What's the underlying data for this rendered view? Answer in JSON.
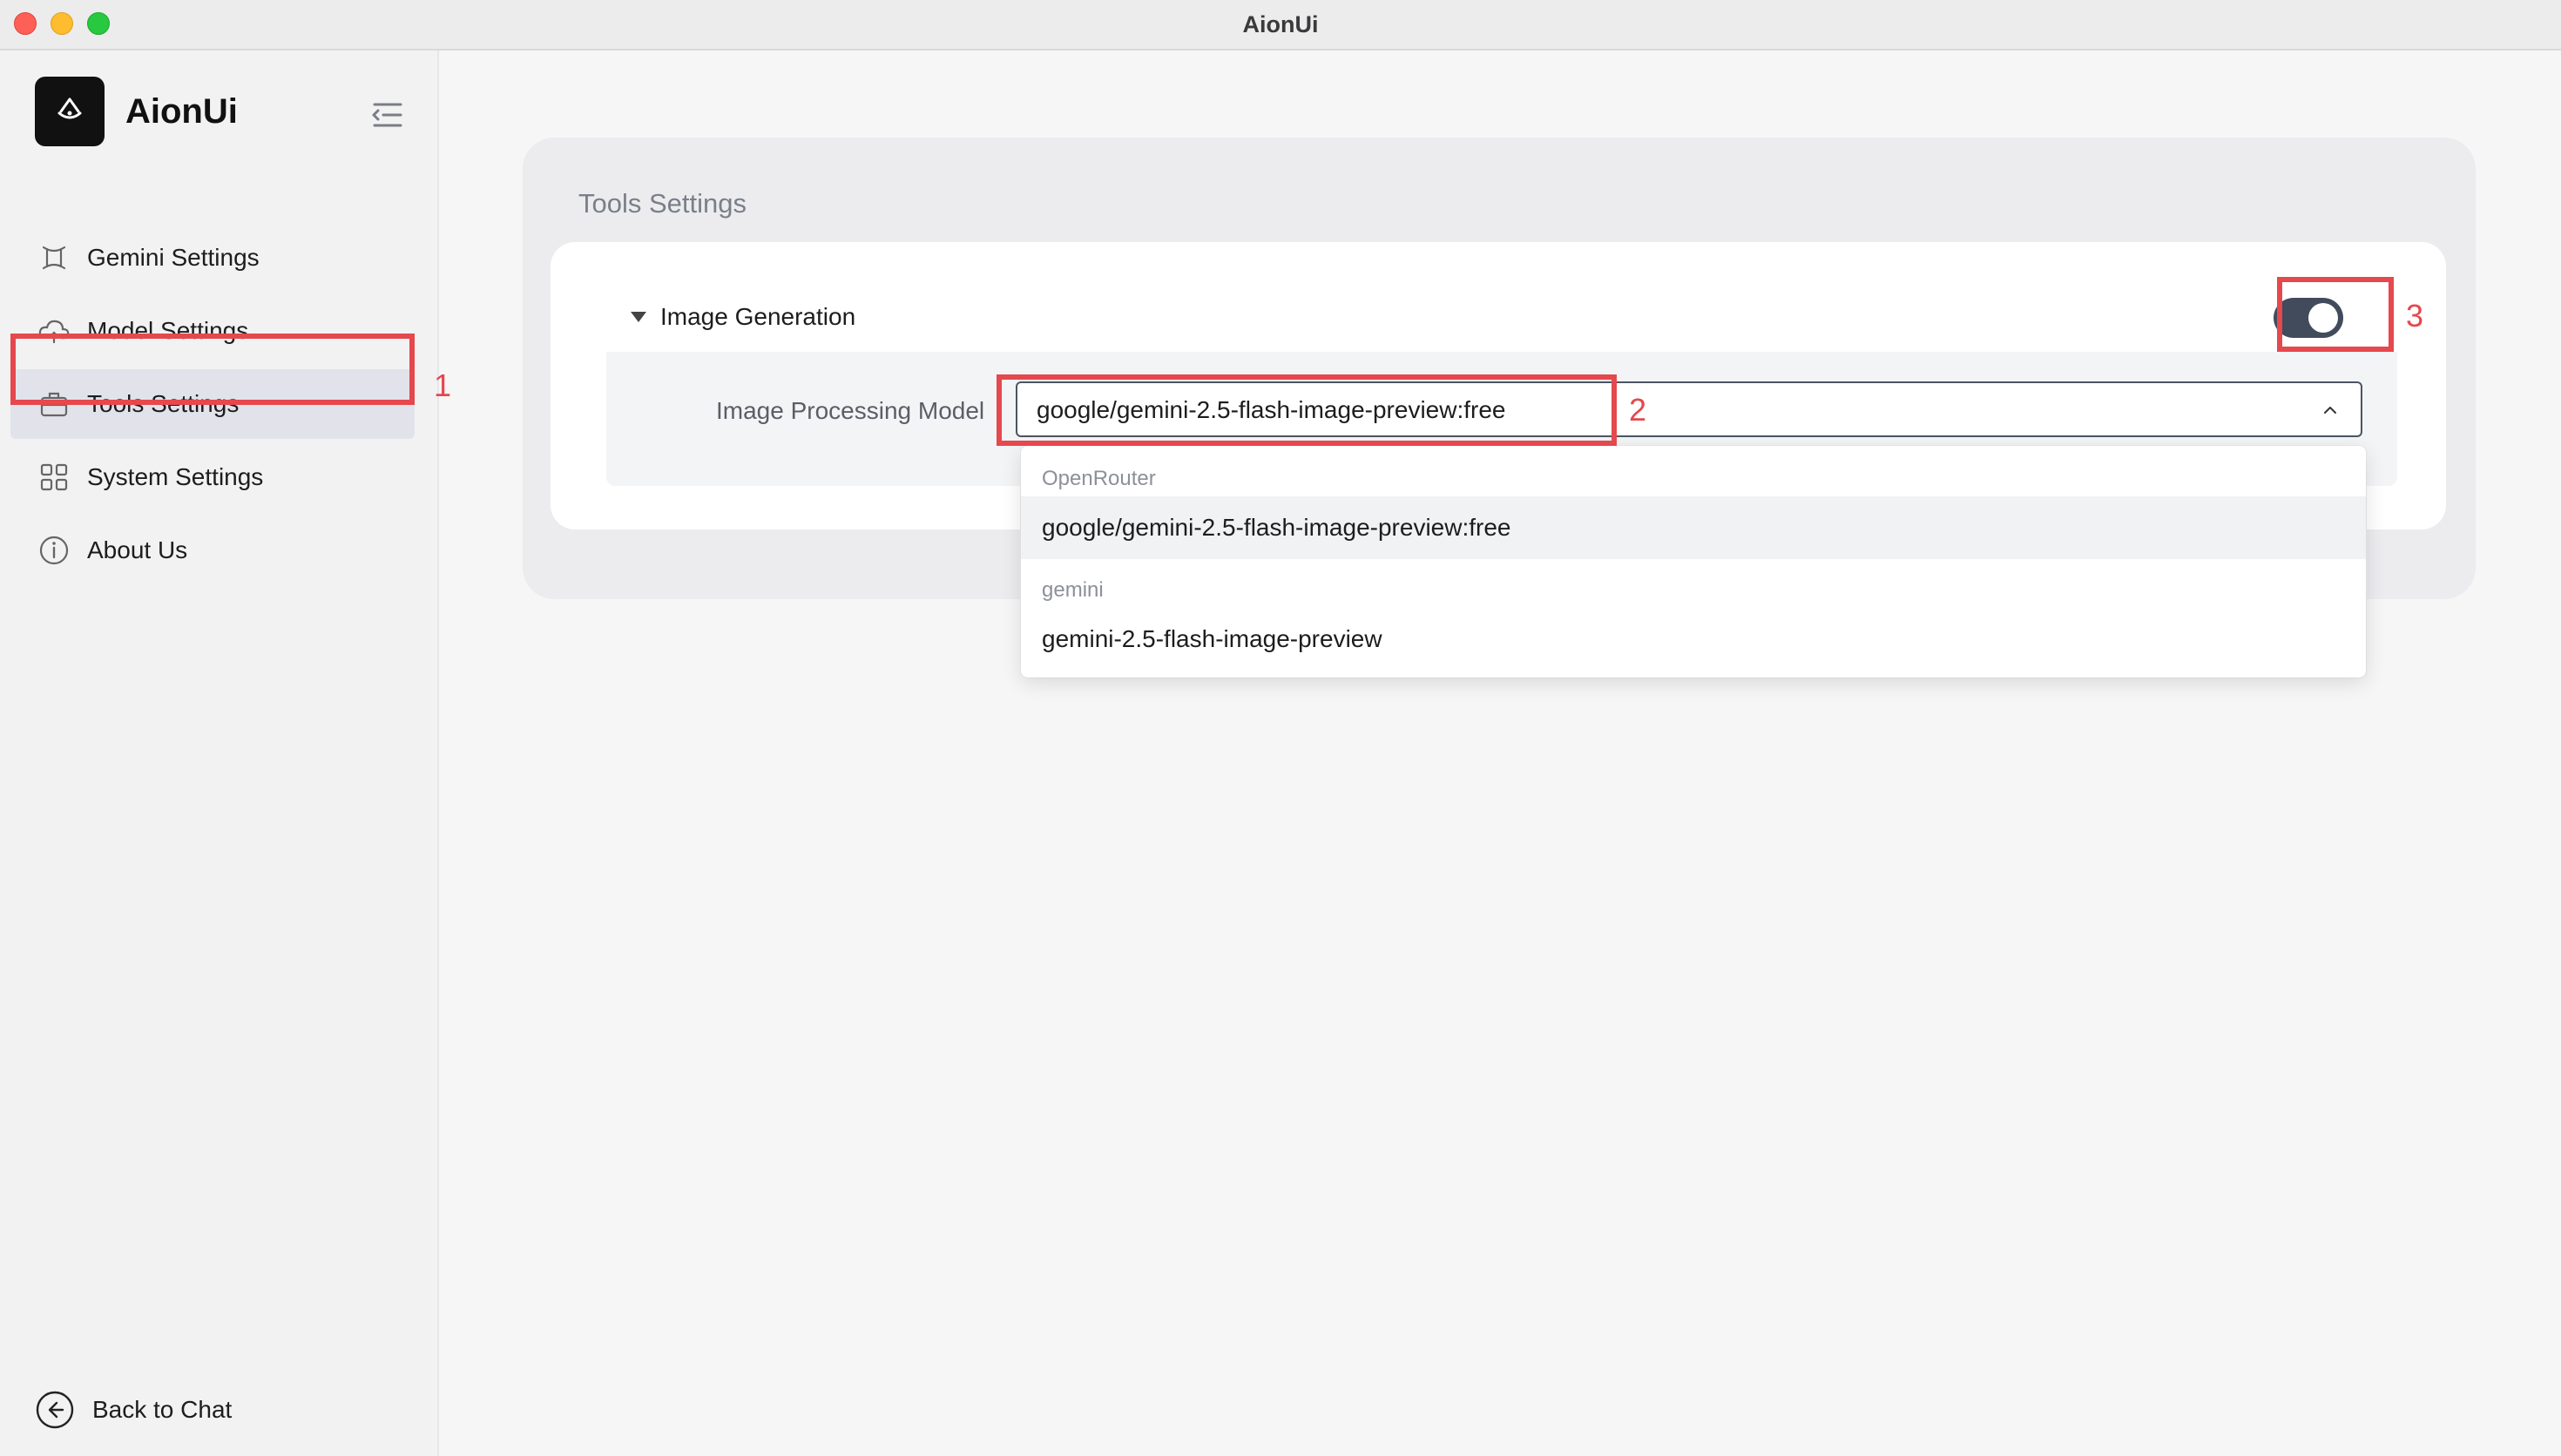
{
  "window": {
    "title": "AionUi"
  },
  "sidebar": {
    "brand": "AionUi",
    "items": [
      {
        "label": "Gemini Settings",
        "icon": "gemini-icon",
        "active": false
      },
      {
        "label": "Model Settings",
        "icon": "cloud-icon",
        "active": false
      },
      {
        "label": "Tools Settings",
        "icon": "toolbox-icon",
        "active": true
      },
      {
        "label": "System Settings",
        "icon": "grid-icon",
        "active": false
      },
      {
        "label": "About Us",
        "icon": "info-icon",
        "active": false
      }
    ],
    "back_label": "Back to Chat"
  },
  "main": {
    "panel_title": "Tools Settings",
    "section": {
      "title": "Image Generation",
      "enabled": true,
      "field_label": "Image Processing Model",
      "selected_value": "google/gemini-2.5-flash-image-preview:free"
    },
    "dropdown": {
      "groups": [
        {
          "label": "OpenRouter",
          "options": [
            "google/gemini-2.5-flash-image-preview:free"
          ]
        },
        {
          "label": "gemini",
          "options": [
            "gemini-2.5-flash-image-preview"
          ]
        }
      ]
    }
  },
  "annotations": [
    "1",
    "2",
    "3"
  ],
  "colors": {
    "annotation": "#e5484d",
    "toggle_on": "#414b5c"
  }
}
